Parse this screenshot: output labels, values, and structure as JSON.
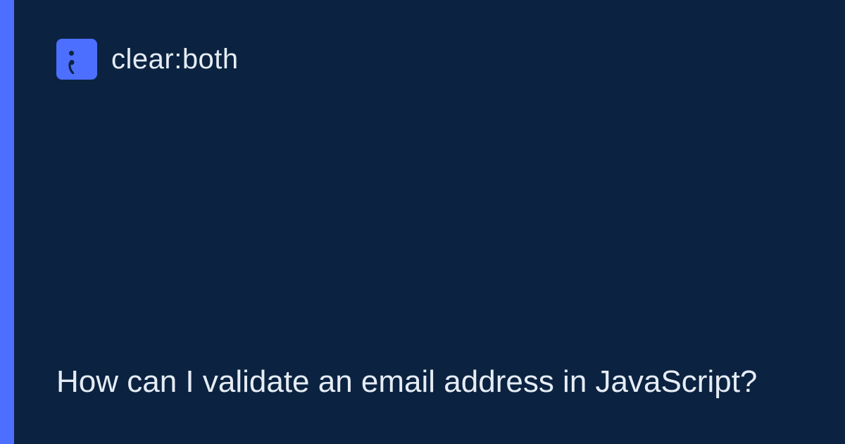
{
  "colors": {
    "background": "#0b2340",
    "accent": "#4c6fff",
    "text": "#e6ecf5"
  },
  "brand": {
    "name": "clear:both",
    "icon": "semicolon-icon"
  },
  "headline": "How can I validate an email address in JavaScript?"
}
